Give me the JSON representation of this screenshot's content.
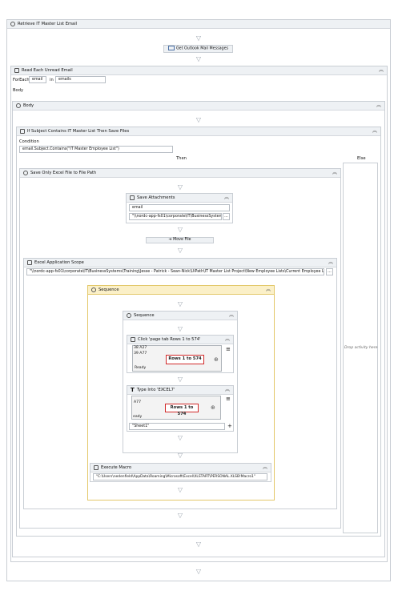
{
  "root": {
    "title": "Retrieve IT Master List Email"
  },
  "get_mail": {
    "label": "Get Outlook Mail Messages"
  },
  "foreach": {
    "title": "Read Each Unread Email",
    "foreach_label": "ForEach",
    "item_var": "email",
    "in_label": "in",
    "collection": "emails",
    "body_label": "Body"
  },
  "body_seq": {
    "title": "Body"
  },
  "if_act": {
    "title": "If Subject Contains IT Master List Then Save Files",
    "condition_label": "Condition",
    "condition": "email.Subject.Contains(\"IT Master Employee List\")",
    "then_label": "Then",
    "else_label": "Else",
    "else_drop": "Drop activity here"
  },
  "save_path_seq": {
    "title": "Save Only Excel File to File Path"
  },
  "save_attach": {
    "title": "Save Attachments",
    "mail": "email",
    "folder": "\"\\\\nordc-app-fs01\\corporate\\IT\\BusinessSystems\\",
    "ellipsis": "..."
  },
  "move_file": {
    "label": "Move File"
  },
  "excel_scope": {
    "title": "Excel Application Scope",
    "path": "\"\\\\nordc-app-fs01\\corporate\\IT\\BusinessSystems\\Training\\Jesse - Patrick - Sean-Nick\\UiPath\\IT Master List Project\\New Employee Lists\\Current Employee List.xlsx\"",
    "ellipsis": "..."
  },
  "sequence_outer": {
    "title": "Sequence"
  },
  "sequence_inner": {
    "title": "Sequence"
  },
  "click_act": {
    "title": "Click 'page tab  Rows 1 to 574'",
    "row_a": "38 A27",
    "row_b": "39 A77",
    "highlight": "Rows 1 to 574",
    "status": "Ready"
  },
  "type_act": {
    "title": "Type Into 'EXCEL7'",
    "row_a": "A77",
    "highlight": "Rows 1 to 574",
    "status": "eady",
    "value": "\"Sheet1\"",
    "plus": "+"
  },
  "macro": {
    "title": "Execute Macro",
    "value": "\"C:\\Users\\nedenfield\\AppData\\Roaming\\Microsoft\\Excel\\XLSTART\\PERSONAL.XLSB!Macro1\""
  },
  "glyphs": {
    "chevron_up": "︽",
    "drop_arrow": "▽",
    "plus_circle": "⊕",
    "menu": "≡",
    "arrow": "➔"
  },
  "icons": [
    "sequence-icon",
    "mail-icon",
    "foreach-icon",
    "if-icon",
    "attachment-icon",
    "excel-icon",
    "click-icon",
    "type-icon",
    "macro-icon"
  ]
}
